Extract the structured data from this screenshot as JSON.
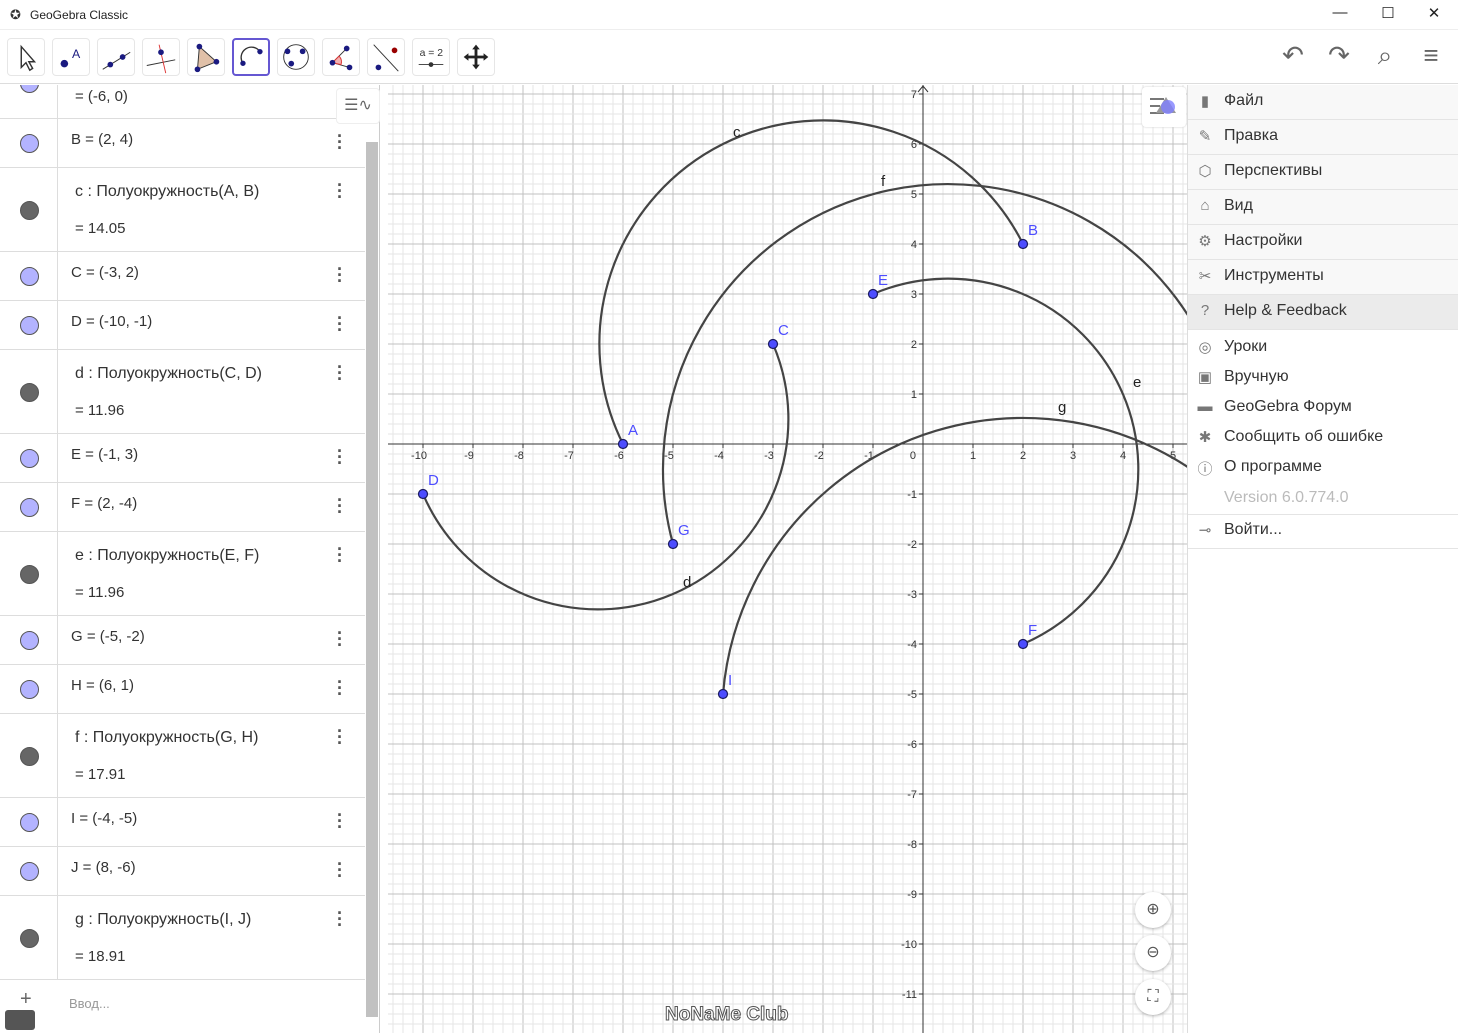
{
  "window": {
    "title": "GeoGebra Classic",
    "minimize": "—",
    "maximize": "☐",
    "close": "✕"
  },
  "toolbar": {
    "tools": [
      "move-tool",
      "point-tool",
      "line-tool",
      "perpendicular-line-tool",
      "polygon-tool",
      "semicircle-tool",
      "circle-through-3-points-tool",
      "angle-tool",
      "reflect-tool",
      "slider-tool",
      "move-graphics-view-tool"
    ],
    "selected": "semicircle-tool",
    "slider_label": "a = 2",
    "right": [
      "undo-icon",
      "redo-icon",
      "search-icon",
      "menu-icon"
    ]
  },
  "algebra": {
    "rows": [
      {
        "def": "",
        "val": "=  (-6, 0)",
        "kind": "point",
        "partial": true
      },
      {
        "def": "B = (2, 4)",
        "kind": "point"
      },
      {
        "def": "c : Полуокружность(A, B)",
        "val": "=  14.05",
        "kind": "curve"
      },
      {
        "def": "C = (-3, 2)",
        "kind": "point"
      },
      {
        "def": "D = (-10, -1)",
        "kind": "point"
      },
      {
        "def": "d : Полуокружность(C, D)",
        "val": "=  11.96",
        "kind": "curve"
      },
      {
        "def": "E = (-1, 3)",
        "kind": "point"
      },
      {
        "def": "F = (2, -4)",
        "kind": "point"
      },
      {
        "def": "e : Полуокружность(E, F)",
        "val": "=  11.96",
        "kind": "curve"
      },
      {
        "def": "G = (-5, -2)",
        "kind": "point"
      },
      {
        "def": "H = (6, 1)",
        "kind": "point"
      },
      {
        "def": "f : Полуокружность(G, H)",
        "val": "=  17.91",
        "kind": "curve"
      },
      {
        "def": "I = (-4, -5)",
        "kind": "point"
      },
      {
        "def": "J = (8, -6)",
        "kind": "point"
      },
      {
        "def": "g : Полуокружность(I, J)",
        "val": "=  18.91",
        "kind": "curve"
      }
    ],
    "input_placeholder": "Ввод...",
    "colors": {
      "point": "#b3b3ff",
      "curve": "#666666"
    }
  },
  "graphics": {
    "points": [
      {
        "name": "A",
        "x": -6,
        "y": 0
      },
      {
        "name": "B",
        "x": 2,
        "y": 4
      },
      {
        "name": "C",
        "x": -3,
        "y": 2
      },
      {
        "name": "D",
        "x": -10,
        "y": -1
      },
      {
        "name": "E",
        "x": -1,
        "y": 3
      },
      {
        "name": "F",
        "x": 2,
        "y": -4
      },
      {
        "name": "G",
        "x": -5,
        "y": -2
      },
      {
        "name": "H",
        "x": 6,
        "y": 1
      },
      {
        "name": "I",
        "x": -4,
        "y": -5
      },
      {
        "name": "J",
        "x": 8,
        "y": -6
      }
    ],
    "semicircles": [
      {
        "name": "c",
        "from": "A",
        "to": "B"
      },
      {
        "name": "d",
        "from": "C",
        "to": "D"
      },
      {
        "name": "e",
        "from": "E",
        "to": "F"
      },
      {
        "name": "f",
        "from": "G",
        "to": "H"
      },
      {
        "name": "g",
        "from": "I",
        "to": "J"
      }
    ],
    "x_ticks": [
      -10,
      -9,
      -8,
      -7,
      -6,
      -5,
      -4,
      -3,
      -2,
      -1,
      1,
      2,
      3,
      4,
      5
    ],
    "y_ticks": [
      7,
      6,
      5,
      4,
      3,
      2,
      1,
      -1,
      -2,
      -3,
      -4,
      -5,
      -6,
      -7,
      -8,
      -9,
      -10,
      -11
    ],
    "origin_label": "0",
    "point_color": "#4d4dff",
    "curve_color": "#444444"
  },
  "menu": {
    "items": [
      {
        "icon": "file-icon",
        "glyph": "▮",
        "label": "Файл"
      },
      {
        "icon": "edit-icon",
        "glyph": "✎",
        "label": "Правка"
      },
      {
        "icon": "perspectives-icon",
        "glyph": "⬡",
        "label": "Перспективы"
      },
      {
        "icon": "home-icon",
        "glyph": "⌂",
        "label": "Вид"
      },
      {
        "icon": "gear-icon",
        "glyph": "⚙",
        "label": "Настройки"
      },
      {
        "icon": "tools-icon",
        "glyph": "✂",
        "label": "Инструменты"
      },
      {
        "icon": "help-icon",
        "glyph": "?",
        "label": "Help & Feedback"
      }
    ],
    "sub": [
      {
        "icon": "tutorials-icon",
        "glyph": "◎",
        "label": "Уроки"
      },
      {
        "icon": "manual-icon",
        "glyph": "▣",
        "label": "Вручную"
      },
      {
        "icon": "forum-icon",
        "glyph": "▬",
        "label": "GeoGebra Форум"
      },
      {
        "icon": "bug-icon",
        "glyph": "✱",
        "label": "Сообщить об ошибке"
      },
      {
        "icon": "info-icon",
        "glyph": "ⓘ",
        "label": "О программе"
      }
    ],
    "version": "Version 6.0.774.0",
    "signin": {
      "icon": "sign-in-icon",
      "glyph": "⊸",
      "label": "Войти..."
    }
  },
  "watermark": "NoNaMe Club"
}
